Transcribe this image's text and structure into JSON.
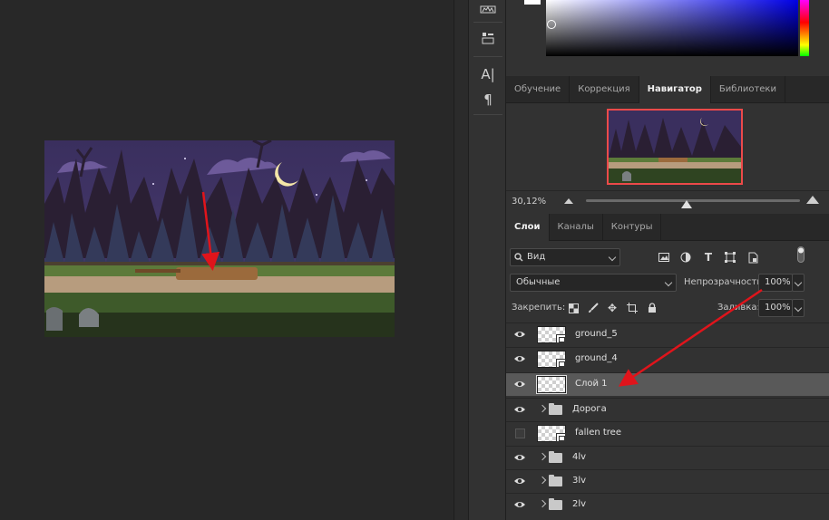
{
  "toolbar": {
    "tools": [
      "histogram-icon",
      "properties-icon",
      "character-icon",
      "paragraph-icon"
    ],
    "char_glyph": "A|",
    "para_glyph": "¶"
  },
  "top_tabs": [
    {
      "label": "Обучение",
      "active": false
    },
    {
      "label": "Коррекция",
      "active": false
    },
    {
      "label": "Навигатор",
      "active": true
    },
    {
      "label": "Библиотеки",
      "active": false
    }
  ],
  "navigator": {
    "zoom": "30,12%",
    "zoom_level": 0.47
  },
  "layers_tabs": [
    {
      "label": "Слои",
      "active": true
    },
    {
      "label": "Каналы",
      "active": false
    },
    {
      "label": "Контуры",
      "active": false
    }
  ],
  "layers_panel": {
    "filter_value": "Вид",
    "blend_mode": "Обычные",
    "opacity_label": "Непрозрачность:",
    "opacity_value": "100%",
    "lock_label": "Закрепить:",
    "fill_label": "Заливка:",
    "fill_value": "100%"
  },
  "layers": [
    {
      "name": "ground_5",
      "visible": true,
      "type": "smart",
      "selected": false
    },
    {
      "name": "ground_4",
      "visible": true,
      "type": "smart",
      "selected": false
    },
    {
      "name": "Слой 1",
      "visible": true,
      "type": "pixel",
      "selected": true
    },
    {
      "name": "Дорога",
      "visible": true,
      "type": "group",
      "selected": false
    },
    {
      "name": "fallen tree",
      "visible": false,
      "type": "smart",
      "selected": false
    },
    {
      "name": "4lv",
      "visible": true,
      "type": "group",
      "selected": false
    },
    {
      "name": "3lv",
      "visible": true,
      "type": "group",
      "selected": false
    },
    {
      "name": "2lv",
      "visible": true,
      "type": "group",
      "selected": false
    }
  ],
  "colors": {
    "annotation_arrow": "#e0141b",
    "navigator_frame": "#ec4a4a",
    "panel_bg": "#323232",
    "canvas_bg": "#282828"
  }
}
